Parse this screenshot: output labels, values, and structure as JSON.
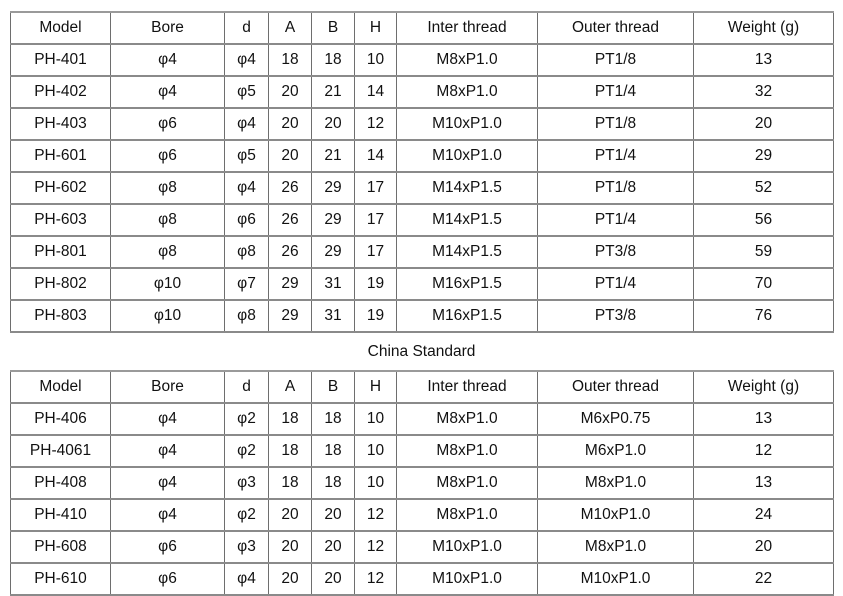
{
  "document": {
    "type": "specification-tables",
    "caption_between_tables": "China Standard"
  },
  "tables": [
    {
      "id": "table-top",
      "columns": [
        "Model",
        "Bore",
        "d",
        "A",
        "B",
        "H",
        "Inter thread",
        "Outer thread",
        "Weight (g)"
      ],
      "rows": [
        [
          "PH-401",
          "φ4",
          "φ4",
          "18",
          "18",
          "10",
          "M8xP1.0",
          "PT1/8",
          "13"
        ],
        [
          "PH-402",
          "φ4",
          "φ5",
          "20",
          "21",
          "14",
          "M8xP1.0",
          "PT1/4",
          "32"
        ],
        [
          "PH-403",
          "φ6",
          "φ4",
          "20",
          "20",
          "12",
          "M10xP1.0",
          "PT1/8",
          "20"
        ],
        [
          "PH-601",
          "φ6",
          "φ5",
          "20",
          "21",
          "14",
          "M10xP1.0",
          "PT1/4",
          "29"
        ],
        [
          "PH-602",
          "φ8",
          "φ4",
          "26",
          "29",
          "17",
          "M14xP1.5",
          "PT1/8",
          "52"
        ],
        [
          "PH-603",
          "φ8",
          "φ6",
          "26",
          "29",
          "17",
          "M14xP1.5",
          "PT1/4",
          "56"
        ],
        [
          "PH-801",
          "φ8",
          "φ8",
          "26",
          "29",
          "17",
          "M14xP1.5",
          "PT3/8",
          "59"
        ],
        [
          "PH-802",
          "φ10",
          "φ7",
          "29",
          "31",
          "19",
          "M16xP1.5",
          "PT1/4",
          "70"
        ],
        [
          "PH-803",
          "φ10",
          "φ8",
          "29",
          "31",
          "19",
          "M16xP1.5",
          "PT3/8",
          "76"
        ]
      ]
    },
    {
      "id": "table-bottom",
      "columns": [
        "Model",
        "Bore",
        "d",
        "A",
        "B",
        "H",
        "Inter thread",
        "Outer thread",
        "Weight (g)"
      ],
      "rows": [
        [
          "PH-406",
          "φ4",
          "φ2",
          "18",
          "18",
          "10",
          "M8xP1.0",
          "M6xP0.75",
          "13"
        ],
        [
          "PH-4061",
          "φ4",
          "φ2",
          "18",
          "18",
          "10",
          "M8xP1.0",
          "M6xP1.0",
          "12"
        ],
        [
          "PH-408",
          "φ4",
          "φ3",
          "18",
          "18",
          "10",
          "M8xP1.0",
          "M8xP1.0",
          "13"
        ],
        [
          "PH-410",
          "φ4",
          "φ2",
          "20",
          "20",
          "12",
          "M8xP1.0",
          "M10xP1.0",
          "24"
        ],
        [
          "PH-608",
          "φ6",
          "φ3",
          "20",
          "20",
          "12",
          "M10xP1.0",
          "M8xP1.0",
          "20"
        ],
        [
          "PH-610",
          "φ6",
          "φ4",
          "20",
          "20",
          "12",
          "M10xP1.0",
          "M10xP1.0",
          "22"
        ]
      ]
    }
  ],
  "colors": {
    "background": "#ffffff",
    "text": "#111111",
    "border_horizontal": "#8a8a8a",
    "border_vertical": "#6e6e6e"
  }
}
